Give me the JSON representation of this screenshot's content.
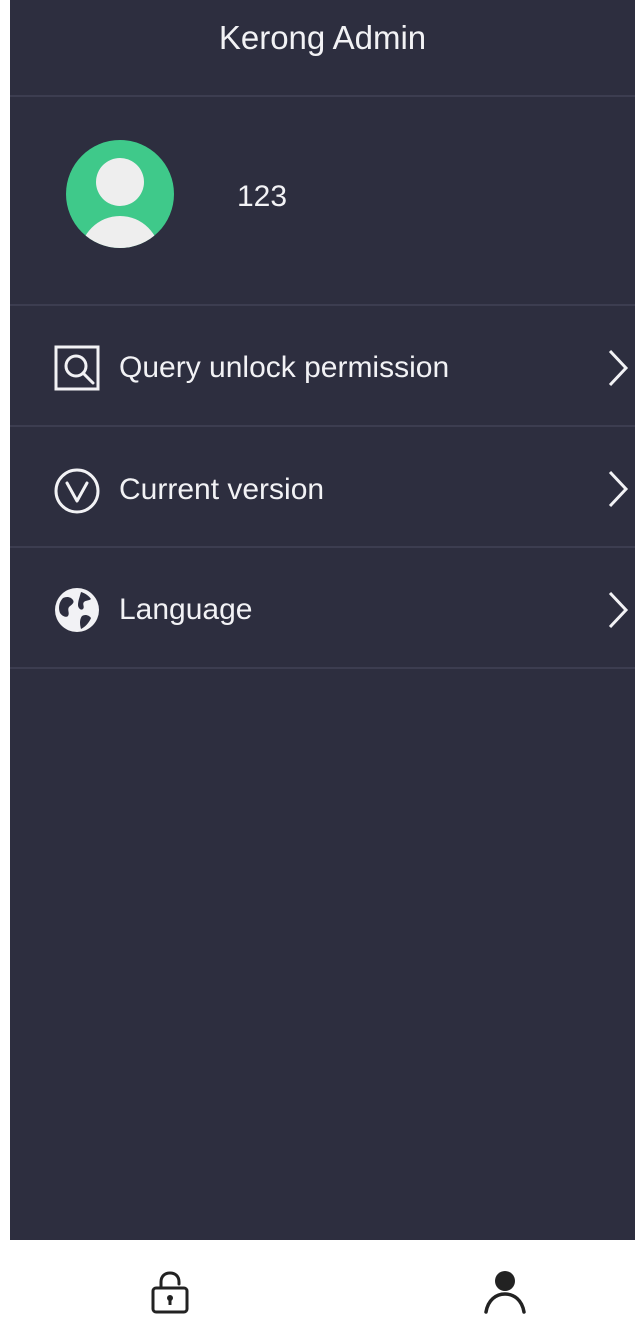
{
  "header": {
    "title": "Kerong Admin"
  },
  "profile": {
    "username": "123",
    "avatar_color": "#3fc98a"
  },
  "menu": {
    "items": [
      {
        "label": "Query unlock permission",
        "icon": "search-document-icon"
      },
      {
        "label": "Current version",
        "icon": "version-icon"
      },
      {
        "label": "Language",
        "icon": "globe-icon"
      }
    ]
  },
  "tabbar": {
    "tabs": [
      {
        "name": "unlock",
        "icon": "lock-icon"
      },
      {
        "name": "profile",
        "icon": "person-icon"
      }
    ]
  },
  "colors": {
    "background": "#2d2e3f",
    "divider": "#3c3d50",
    "text": "#f2f2f5",
    "tabbar": "#ffffff"
  }
}
